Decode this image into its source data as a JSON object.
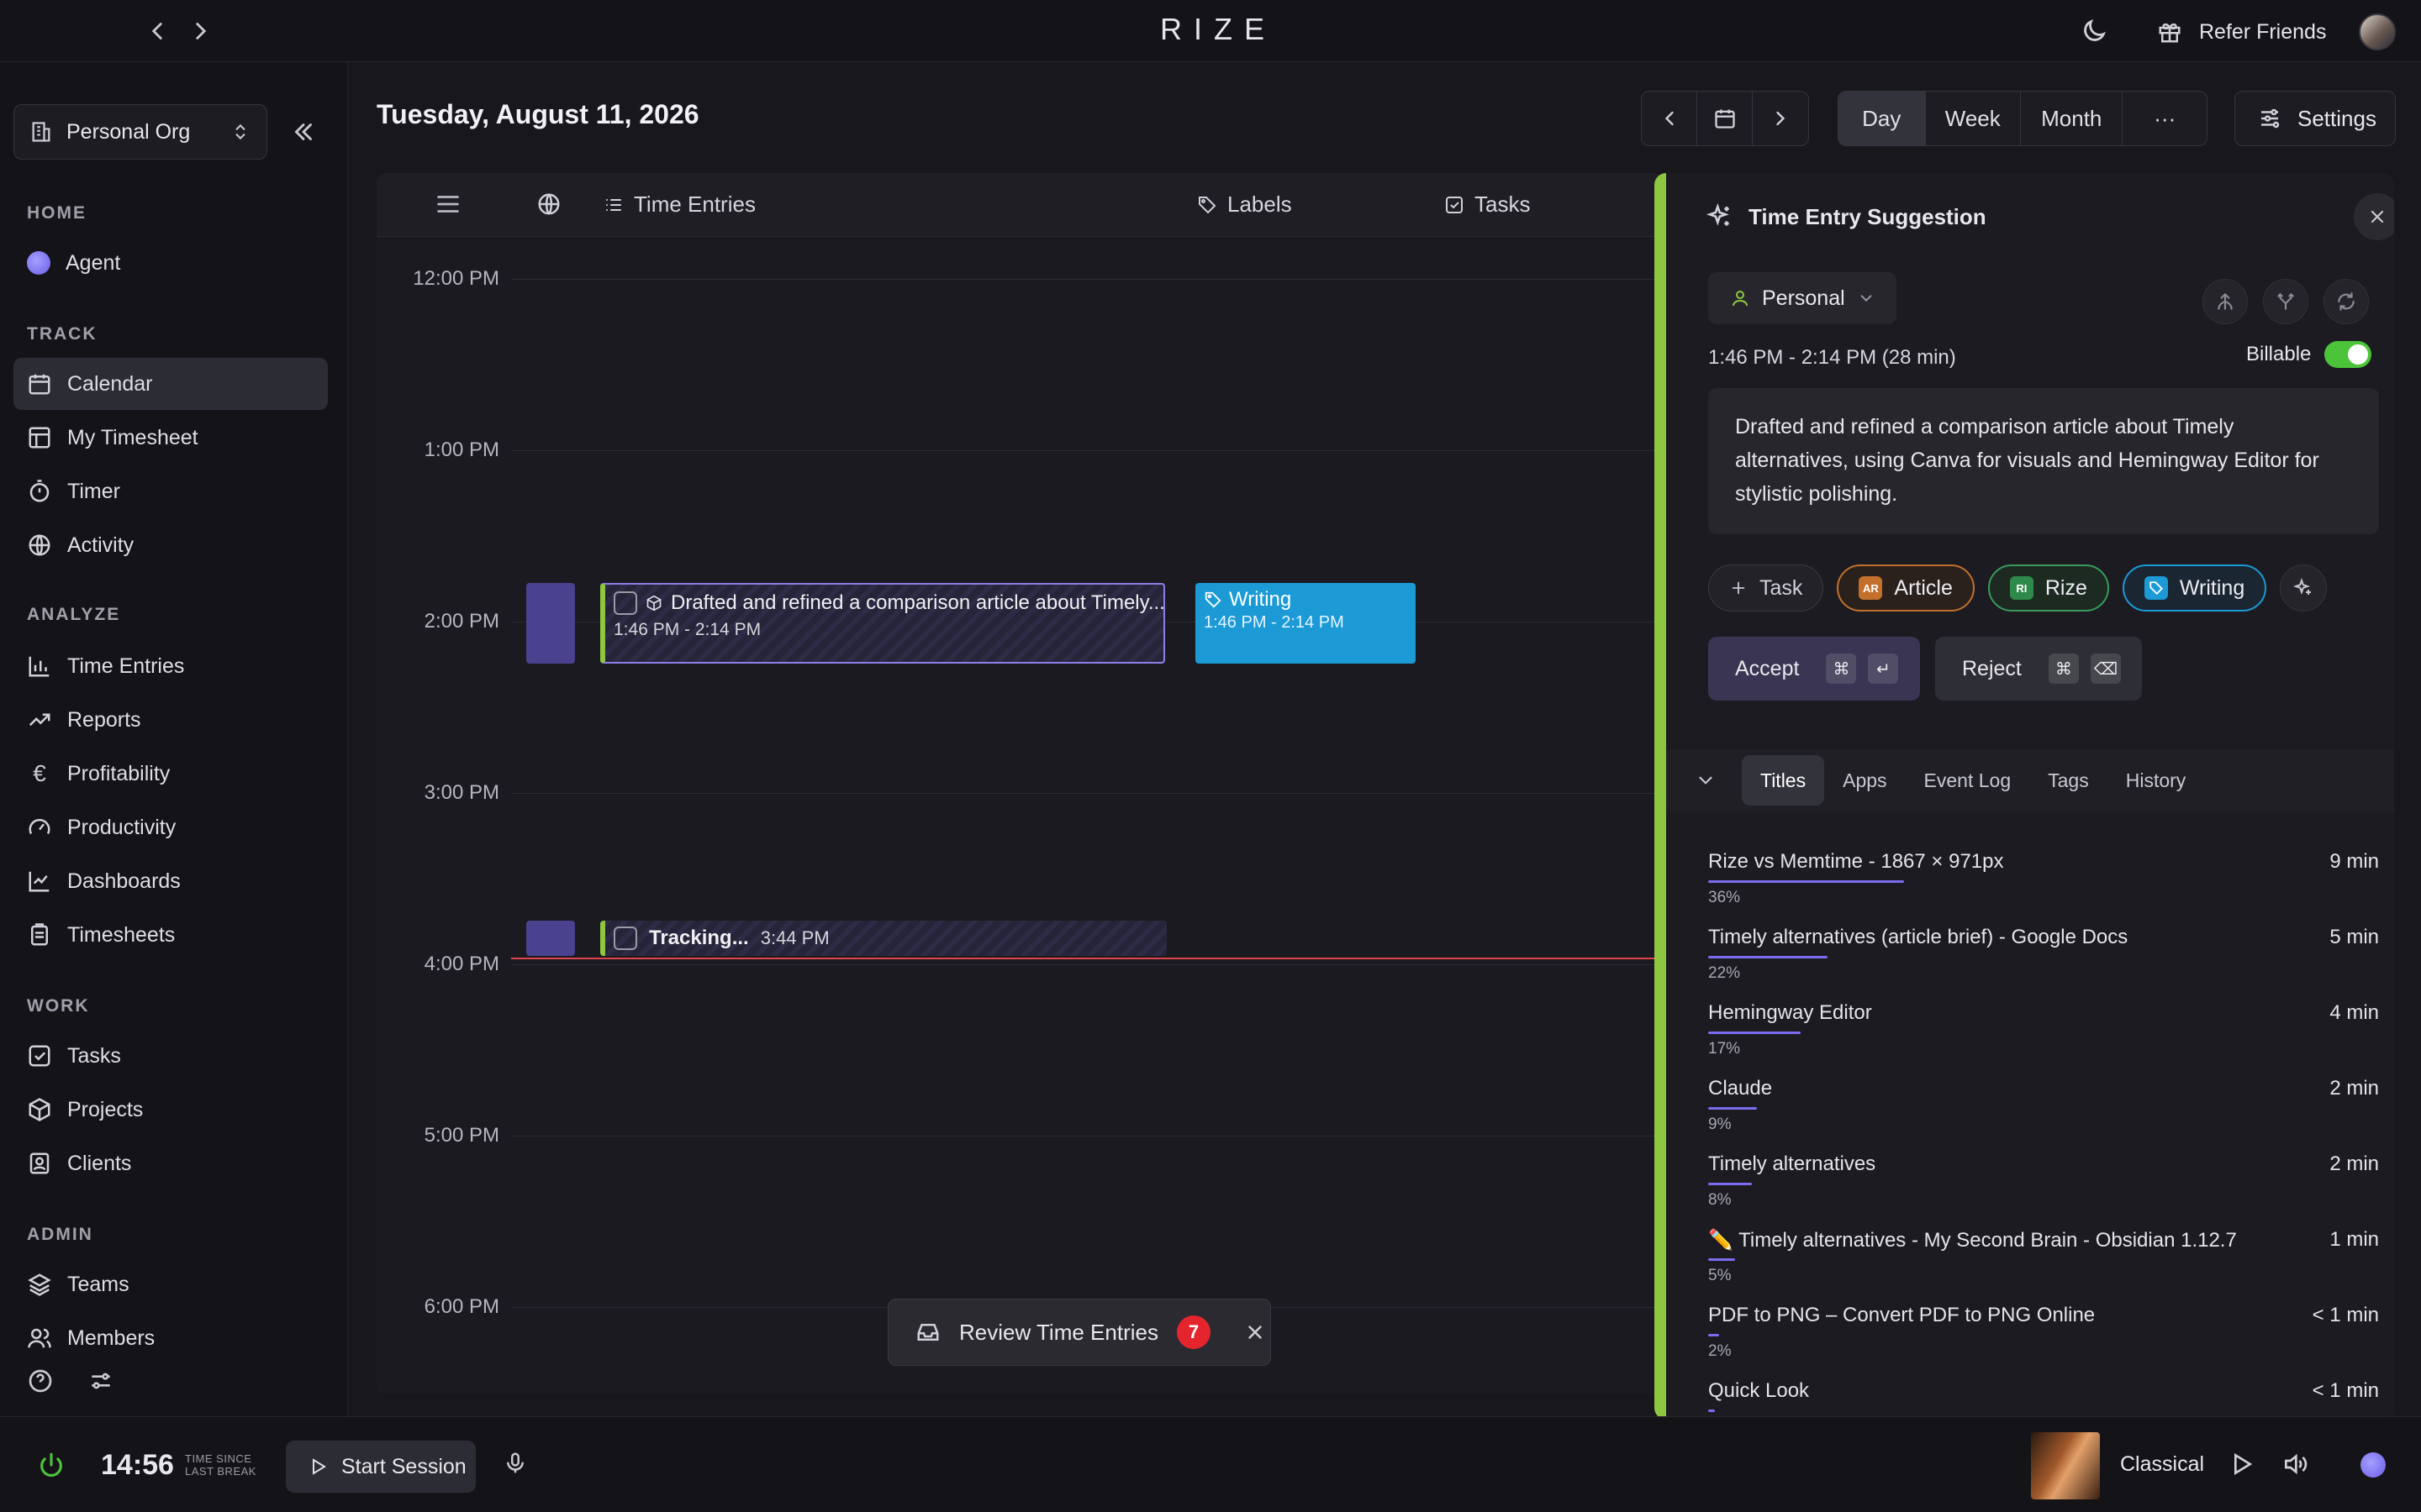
{
  "app": {
    "logo": "RIZE"
  },
  "topbar": {
    "refer_label": "Refer Friends"
  },
  "sidebar": {
    "org_name": "Personal Org",
    "sections": {
      "home": "HOME",
      "track": "TRACK",
      "analyze": "ANALYZE",
      "work": "WORK",
      "admin": "ADMIN"
    },
    "items": {
      "agent": "Agent",
      "calendar": "Calendar",
      "my_timesheet": "My Timesheet",
      "timer": "Timer",
      "activity": "Activity",
      "time_entries": "Time Entries",
      "reports": "Reports",
      "profitability": "Profitability",
      "productivity": "Productivity",
      "dashboards": "Dashboards",
      "timesheets": "Timesheets",
      "tasks": "Tasks",
      "projects": "Projects",
      "clients": "Clients",
      "teams": "Teams",
      "members": "Members"
    }
  },
  "header": {
    "date": "Tuesday, August 11, 2026",
    "views": {
      "day": "Day",
      "week": "Week",
      "month": "Month",
      "more": "···"
    },
    "settings": "Settings"
  },
  "calendar": {
    "columns": {
      "time_entries": "Time Entries",
      "labels": "Labels",
      "tasks": "Tasks"
    },
    "hours": [
      "12:00 PM",
      "1:00 PM",
      "2:00 PM",
      "3:00 PM",
      "4:00 PM",
      "5:00 PM",
      "6:00 PM"
    ],
    "entry": {
      "title": "Drafted and refined a comparison article about Timely...",
      "time": "1:46 PM - 2:14 PM"
    },
    "label_entry": {
      "title": "Writing",
      "time": "1:46 PM - 2:14 PM"
    },
    "tracking": {
      "title": "Tracking...",
      "time": "3:44 PM"
    }
  },
  "review": {
    "label": "Review Time Entries",
    "count": "7"
  },
  "panel": {
    "title": "Time Entry Suggestion",
    "workspace": "Personal",
    "time_range": "1:46 PM - 2:14 PM (28 min)",
    "billable_label": "Billable",
    "description": "Drafted and refined a comparison article about Timely alternatives, using Canva for visuals and Hemingway Editor for stylistic polishing.",
    "chips": {
      "task": "Task",
      "article": "Article",
      "article_abbr": "AR",
      "rize": "Rize",
      "rize_abbr": "RI",
      "writing": "Writing"
    },
    "accept": "Accept",
    "reject": "Reject",
    "tabs": {
      "titles": "Titles",
      "apps": "Apps",
      "event_log": "Event Log",
      "tags": "Tags",
      "history": "History"
    },
    "titles": [
      {
        "title": "Rize vs Memtime - 1867 × 971px",
        "duration": "9 min",
        "percent": "36%",
        "share": 0.36
      },
      {
        "title": "Timely alternatives (article brief) - Google Docs",
        "duration": "5 min",
        "percent": "22%",
        "share": 0.22
      },
      {
        "title": "Hemingway Editor",
        "duration": "4 min",
        "percent": "17%",
        "share": 0.17
      },
      {
        "title": "Claude",
        "duration": "2 min",
        "percent": "9%",
        "share": 0.09
      },
      {
        "title": "Timely alternatives",
        "duration": "2 min",
        "percent": "8%",
        "share": 0.08
      },
      {
        "title": "✏️ Timely alternatives - My Second Brain - Obsidian 1.12.7",
        "duration": "1 min",
        "percent": "5%",
        "share": 0.05
      },
      {
        "title": "PDF to PNG – Convert PDF to PNG Online",
        "duration": "< 1 min",
        "percent": "2%",
        "share": 0.02
      },
      {
        "title": "Quick Look",
        "duration": "< 1 min",
        "percent": "",
        "share": 0.01
      }
    ]
  },
  "bottombar": {
    "elapsed": "14:56",
    "elapsed_label_1": "TIME SINCE",
    "elapsed_label_2": "LAST BREAK",
    "start_session": "Start Session",
    "music": "Classical"
  },
  "colors": {
    "accent_purple": "#7b6cf0",
    "writing_blue": "#1b9ad6",
    "billable_green": "#4cc43a",
    "entry_green": "#8ec641",
    "now_line": "#e0444c"
  }
}
